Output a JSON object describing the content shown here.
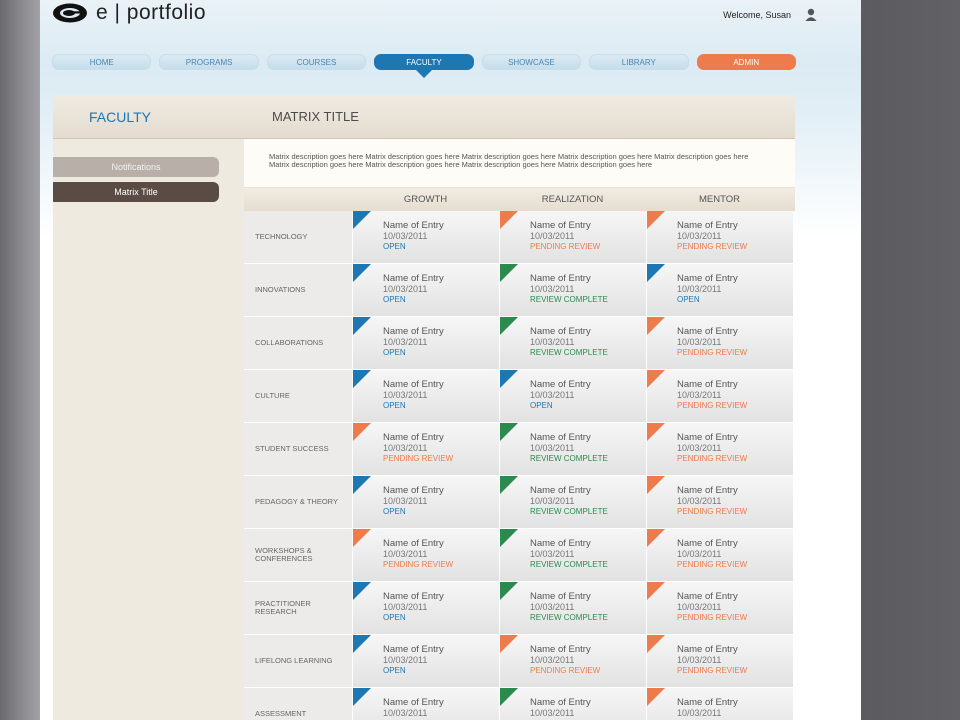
{
  "app": {
    "logo_text": "e | portfolio",
    "welcome": "Welcome, Susan"
  },
  "nav": {
    "tabs": [
      {
        "label": "HOME",
        "state": "normal"
      },
      {
        "label": "PROGRAMS",
        "state": "normal"
      },
      {
        "label": "COURSES",
        "state": "normal"
      },
      {
        "label": "FACULTY",
        "state": "active"
      },
      {
        "label": "SHOWCASE",
        "state": "normal"
      },
      {
        "label": "LIBRARY",
        "state": "normal"
      },
      {
        "label": "ADMIN",
        "state": "admin"
      }
    ]
  },
  "sidebar": {
    "title": "FACULTY",
    "items": [
      "Notifications",
      "Matrix Title"
    ]
  },
  "main": {
    "title": "MATRIX TITLE",
    "description": "Matrix description goes here Matrix description goes here Matrix description goes here Matrix description goes here Matrix description goes here Matrix description goes here Matrix description goes here Matrix description goes here Matrix description goes here"
  },
  "matrix": {
    "columns": [
      "GROWTH",
      "REALIZATION",
      "MENTOR"
    ],
    "status_labels": {
      "open": "OPEN",
      "pending": "PENDING REVIEW",
      "complete": "REVIEW COMPLETE"
    },
    "status_colors": {
      "open": "#1d77b3",
      "pending": "#ee7b4b",
      "complete": "#2b8a4e"
    },
    "rows": [
      {
        "label": "TECHNOLOGY",
        "cells": [
          {
            "name": "Name of Entry",
            "date": "10/03/2011",
            "status": "open"
          },
          {
            "name": "Name of Entry",
            "date": "10/03/2011",
            "status": "pending"
          },
          {
            "name": "Name of Entry",
            "date": "10/03/2011",
            "status": "pending"
          }
        ]
      },
      {
        "label": "INNOVATIONS",
        "cells": [
          {
            "name": "Name of Entry",
            "date": "10/03/2011",
            "status": "open"
          },
          {
            "name": "Name of Entry",
            "date": "10/03/2011",
            "status": "complete"
          },
          {
            "name": "Name of Entry",
            "date": "10/03/2011",
            "status": "open"
          }
        ]
      },
      {
        "label": "COLLABORATIONS",
        "cells": [
          {
            "name": "Name of Entry",
            "date": "10/03/2011",
            "status": "open"
          },
          {
            "name": "Name of Entry",
            "date": "10/03/2011",
            "status": "complete"
          },
          {
            "name": "Name of Entry",
            "date": "10/03/2011",
            "status": "pending"
          }
        ]
      },
      {
        "label": "CULTURE",
        "cells": [
          {
            "name": "Name of Entry",
            "date": "10/03/2011",
            "status": "open"
          },
          {
            "name": "Name of Entry",
            "date": "10/03/2011",
            "status": "open"
          },
          {
            "name": "Name of Entry",
            "date": "10/03/2011",
            "status": "pending"
          }
        ]
      },
      {
        "label": "STUDENT SUCCESS",
        "cells": [
          {
            "name": "Name of Entry",
            "date": "10/03/2011",
            "status": "pending"
          },
          {
            "name": "Name of Entry",
            "date": "10/03/2011",
            "status": "complete"
          },
          {
            "name": "Name of Entry",
            "date": "10/03/2011",
            "status": "pending"
          }
        ]
      },
      {
        "label": "PEDAGOGY & THEORY",
        "cells": [
          {
            "name": "Name of Entry",
            "date": "10/03/2011",
            "status": "open"
          },
          {
            "name": "Name of Entry",
            "date": "10/03/2011",
            "status": "complete"
          },
          {
            "name": "Name of Entry",
            "date": "10/03/2011",
            "status": "pending"
          }
        ]
      },
      {
        "label": "WORKSHOPS & CONFERENCES",
        "cells": [
          {
            "name": "Name of Entry",
            "date": "10/03/2011",
            "status": "pending"
          },
          {
            "name": "Name of Entry",
            "date": "10/03/2011",
            "status": "complete"
          },
          {
            "name": "Name of Entry",
            "date": "10/03/2011",
            "status": "pending"
          }
        ]
      },
      {
        "label": "PRACTITIONER RESEARCH",
        "cells": [
          {
            "name": "Name of Entry",
            "date": "10/03/2011",
            "status": "open"
          },
          {
            "name": "Name of Entry",
            "date": "10/03/2011",
            "status": "complete"
          },
          {
            "name": "Name of Entry",
            "date": "10/03/2011",
            "status": "pending"
          }
        ]
      },
      {
        "label": "LIFELONG LEARNING",
        "cells": [
          {
            "name": "Name of Entry",
            "date": "10/03/2011",
            "status": "open"
          },
          {
            "name": "Name of Entry",
            "date": "10/03/2011",
            "status": "pending"
          },
          {
            "name": "Name of Entry",
            "date": "10/03/2011",
            "status": "pending"
          }
        ]
      },
      {
        "label": "ASSESSMENT",
        "cells": [
          {
            "name": "Name of Entry",
            "date": "10/03/2011",
            "status": "open"
          },
          {
            "name": "Name of Entry",
            "date": "10/03/2011",
            "status": "complete"
          },
          {
            "name": "Name of Entry",
            "date": "10/03/2011",
            "status": "pending"
          }
        ]
      }
    ]
  }
}
